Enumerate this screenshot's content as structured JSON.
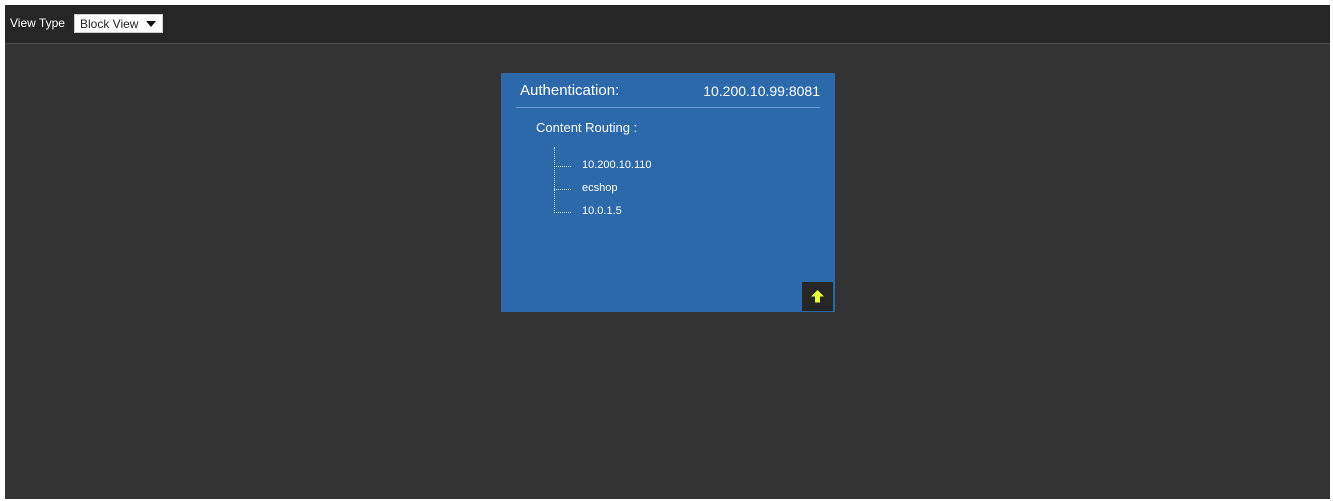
{
  "toolbar": {
    "view_type_label": "View Type",
    "view_select_value": "Block View"
  },
  "card": {
    "auth_label": "Authentication:",
    "auth_value": "10.200.10.99:8081",
    "routing_title": "Content Routing :",
    "routes": [
      "10.200.10.110",
      "ecshop",
      "10.0.1.5"
    ],
    "up_button_icon": "arrow-up-icon",
    "up_button_icon_color": "#e8ff3a",
    "background_color": "#2b69ab"
  }
}
